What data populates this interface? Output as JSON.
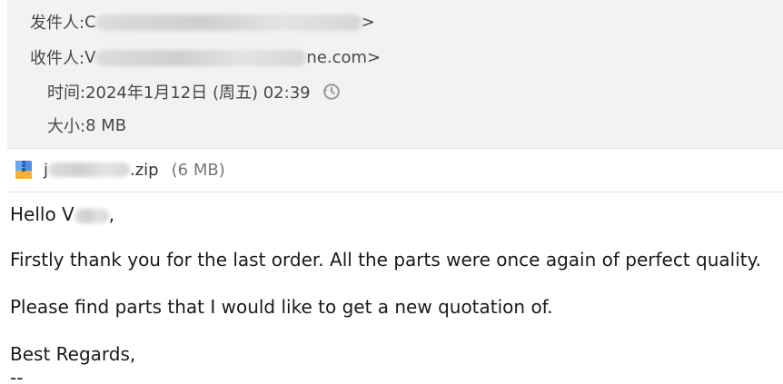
{
  "header": {
    "from": {
      "label": "发件人:",
      "value_start": "C",
      "value_end": ">"
    },
    "to": {
      "label": "收件人:",
      "value_start": "V",
      "value_end": "ne.com>"
    },
    "time": {
      "label": "时间:",
      "value": "2024年1月12日 (周五) 02:39",
      "icon": "history-icon"
    },
    "size": {
      "label": "大小:",
      "value": "8 MB"
    }
  },
  "attachment": {
    "icon": "zip-archive-icon",
    "name_start": "j",
    "name_end": ".zip",
    "size": "(6 MB)"
  },
  "body": {
    "greeting_start": "Hello V",
    "greeting_end": ",",
    "line1": "Firstly thank you for the last order. All the parts were once again of perfect quality.",
    "line2": "Please find parts that I would like to get a new quotation of.",
    "closing": "Best Regards,",
    "signature_sep": "--"
  },
  "colors": {
    "header_bg": "#f2f2f2",
    "label_text": "#474747",
    "body_text": "#1a1a1a",
    "icon_gray": "#9a9a9a"
  }
}
